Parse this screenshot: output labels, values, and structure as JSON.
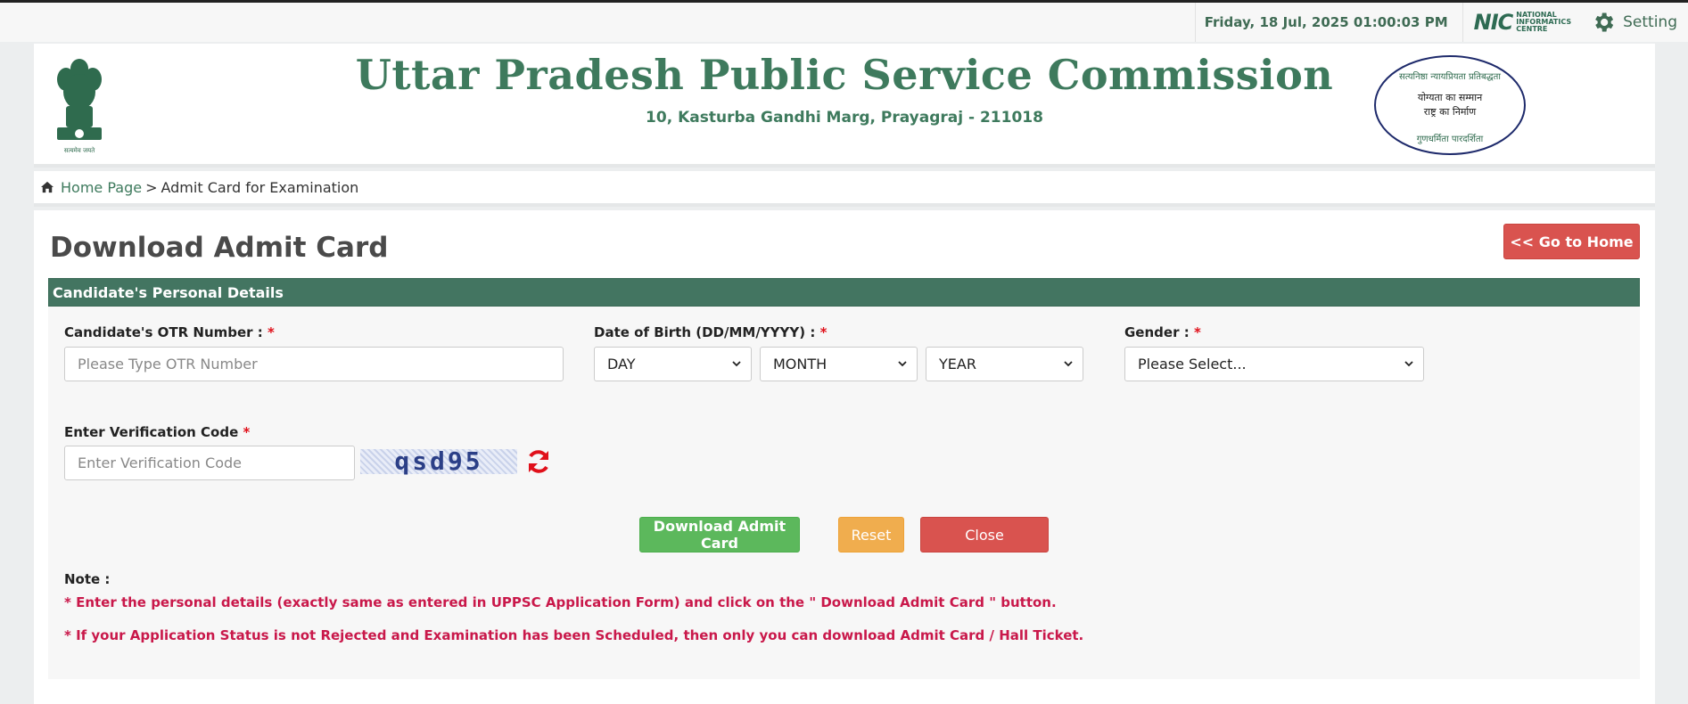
{
  "topbar": {
    "datetime": "Friday, 18 Jul, 2025 01:00:03 PM",
    "nic_logo": "NIC",
    "nic_text_1": "NATIONAL",
    "nic_text_2": "INFORMATICS",
    "nic_text_3": "CENTRE",
    "setting_label": "Setting",
    "setting_icon": "gear-icon"
  },
  "header": {
    "title": "Uttar Pradesh Public Service Commission",
    "address": "10, Kasturba Gandhi Marg, Prayagraj - 211018",
    "emblem_caption": "सत्यमेव जयते",
    "seal_line_1": "सत्यनिष्ठा न्यायप्रियता प्रतिबद्धता",
    "seal_line_2": "योग्यता का सम्मान",
    "seal_line_3": "राष्ट्र का निर्माण",
    "seal_line_4": "गुणधर्मिता पारदर्शिता"
  },
  "breadcrumb": {
    "home": "Home Page",
    "separator": ">",
    "current": "Admit Card for Examination"
  },
  "main": {
    "page_title": "Download Admit Card",
    "go_home_label": "<< Go to Home",
    "panel_title": "Candidate's Personal Details",
    "otr_label": "Candidate's OTR Number :",
    "otr_placeholder": "Please Type OTR Number",
    "dob_label": "Date of Birth (DD/MM/YYYY) :",
    "dob_day": "DAY",
    "dob_month": "MONTH",
    "dob_year": "YEAR",
    "gender_label": "Gender :",
    "gender_value": "Please Select...",
    "verify_label": "Enter Verification Code",
    "verify_placeholder": "Enter Verification Code",
    "captcha_text": "qsd95",
    "required_mark": "*",
    "download_label": "Download Admit Card",
    "reset_label": "Reset",
    "close_label": "Close",
    "note_label": "Note :",
    "note_1_pre": "* Enter the personal details (exactly same as entered in UPPSC Application Form) and click on the \" ",
    "note_1_bold": "Download Admit Card",
    "note_1_post": " \" button.",
    "note_2": "* If your Application Status is not Rejected and Examination has been Scheduled, then only you can download Admit Card / Hall Ticket."
  },
  "colors": {
    "brand_green": "#437561",
    "title_green": "#3e7a5d",
    "danger": "#d9534f",
    "success": "#5cb85c",
    "warning": "#f0ad4e",
    "note_red": "#c9184a"
  }
}
